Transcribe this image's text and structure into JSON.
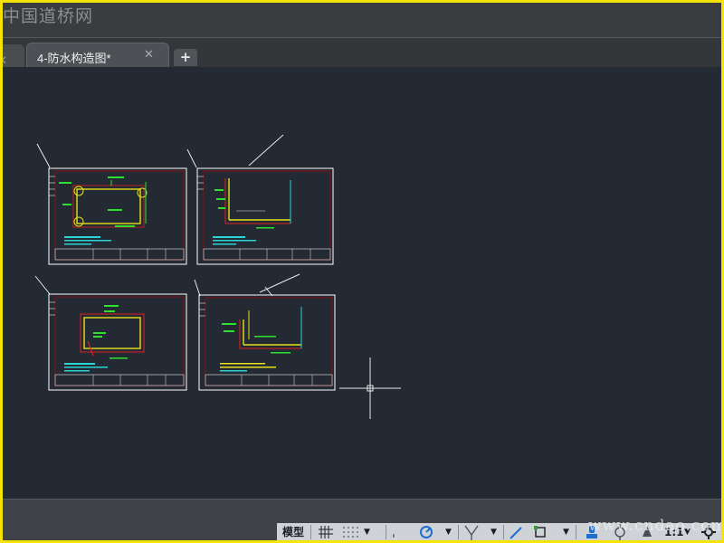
{
  "watermark_top": "中国道桥网",
  "tabs": [
    {
      "label": "4-防水构造图*",
      "active": true,
      "close_icon": "close-icon"
    }
  ],
  "add_tab_label": "+",
  "status_bar": {
    "model_label": "模型",
    "scale_label": "1:1",
    "watermark": "www.cndao.com"
  },
  "colors": {
    "accent_border": "#f5e400",
    "canvas_bg": "#232a33",
    "sheet_border": "#ffffff",
    "sheet_inner_border": "#8a0f14",
    "drawing_yellow": "#e8e01a",
    "drawing_green": "#2fe02f",
    "drawing_cyan": "#2bd4d4",
    "drawing_red": "#e02020"
  }
}
